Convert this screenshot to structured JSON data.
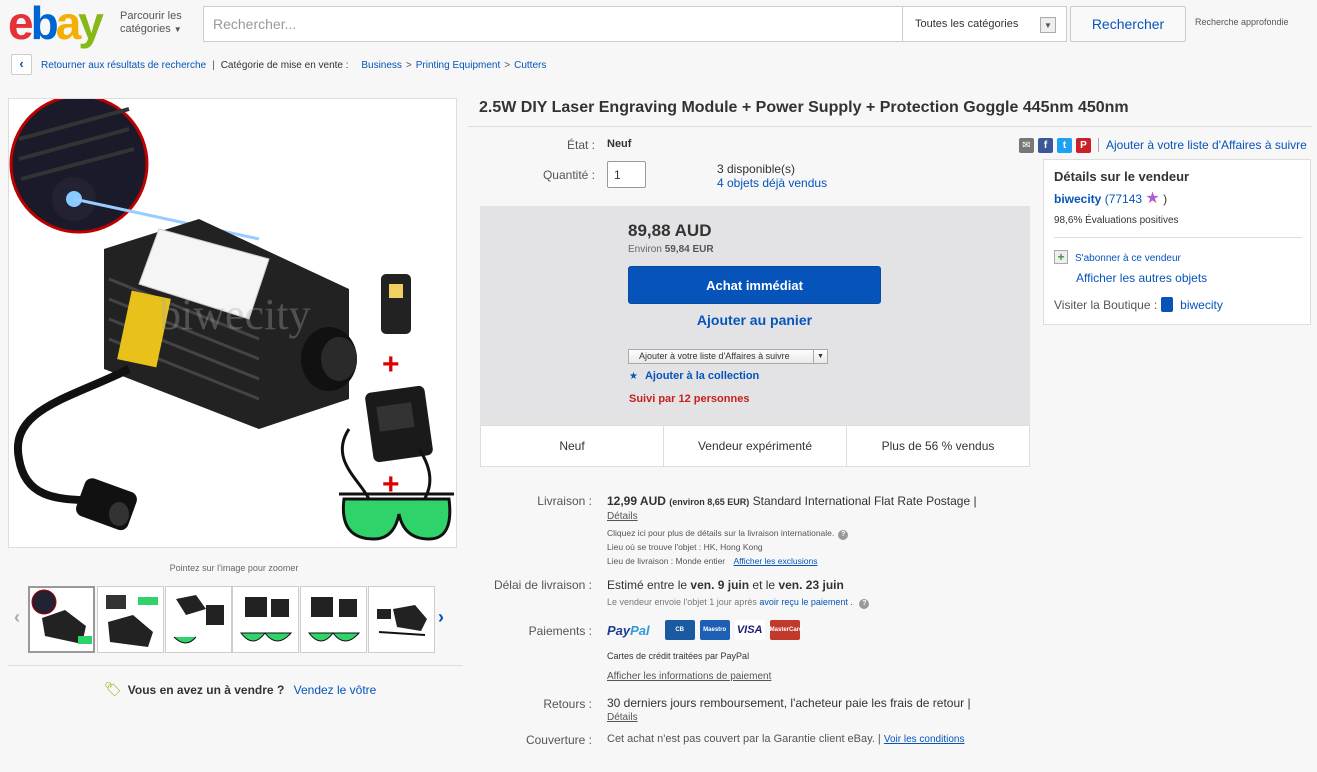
{
  "header": {
    "logo_letters": [
      "e",
      "b",
      "a",
      "y"
    ],
    "logo_colors": [
      "#e53238",
      "#0064d2",
      "#f5af02",
      "#86b817"
    ],
    "browse_line1": "Parcourir les",
    "browse_line2": "catégories",
    "search_placeholder": "Rechercher...",
    "category_select": "Toutes les catégories",
    "search_button": "Rechercher",
    "advanced_search": "Recherche approfondie"
  },
  "breadcrumb": {
    "back_label": "Retourner aux résultats de recherche",
    "category_label": "Catégorie de mise en vente :",
    "items": [
      "Business",
      "Printing Equipment",
      "Cutters"
    ]
  },
  "gallery": {
    "zoom_hint": "Pointez sur l'image pour zoomer",
    "watermark": "biwecity",
    "thumb_count": 6
  },
  "sell_question": {
    "question": "Vous en avez un à vendre ?",
    "link": "Vendez le vôtre"
  },
  "item": {
    "title": "2.5W DIY Laser Engraving Module + Power Supply + Protection Goggle 445nm 450nm",
    "condition_label": "État :",
    "condition_value": "Neuf",
    "quantity_label": "Quantité :",
    "quantity_value": "1",
    "available": "3 disponible(s)",
    "sold": "4 objets déjà vendus"
  },
  "share": {
    "watch_link": "Ajouter à votre liste d'Affaires à suivre"
  },
  "buybox": {
    "price": "89,88 AUD",
    "approx_prefix": "Environ",
    "approx_value": "59,84 EUR",
    "buy_now": "Achat immédiat",
    "add_to_cart": "Ajouter au panier",
    "watch_dropdown": "Ajouter à votre liste d'Affaires à suivre",
    "add_collection": "Ajouter à la collection",
    "followers": "Suivi par 12 personnes"
  },
  "badges": [
    "Neuf",
    "Vendeur expérimenté",
    "Plus de 56 % vendus"
  ],
  "seller": {
    "title": "Détails sur le vendeur",
    "name": "biwecity",
    "score": "(77143",
    "score_close": ")",
    "positive": "98,6% Évaluations positives",
    "subscribe": "S'abonner à ce vendeur",
    "other_items": "Afficher les autres objets",
    "visit_shop": "Visiter la Boutique :",
    "shop_name": "biwecity"
  },
  "shipping": {
    "label": "Livraison :",
    "price": "12,99 AUD",
    "approx": "(environ 8,65 EUR)",
    "service": "Standard International Flat Rate Postage |",
    "details": "Détails",
    "info1": "Cliquez ici pour plus de détails sur la livraison internationale.",
    "info2": "Lieu où se trouve l'objet :  HK, Hong Kong",
    "info3_prefix": "Lieu de livraison :  Monde entier",
    "info3_link": "Afficher les exclusions"
  },
  "delivery": {
    "label": "Délai de livraison :",
    "prefix": "Estimé entre le",
    "date1": "ven. 9 juin",
    "middle": "et le",
    "date2": "ven. 23 juin",
    "note": "Le vendeur envoie l'objet 1 jour après",
    "note_link": "avoir reçu le paiement ."
  },
  "payment": {
    "label": "Paiements :",
    "paypal_a": "Pay",
    "paypal_b": "Pal",
    "cards": [
      "CB",
      "Maestro",
      "VISA",
      "MasterCard"
    ],
    "card_colors": [
      "#1b5aa0",
      "#1c5fb5",
      "#1a1f71",
      "#c0392b"
    ],
    "processed": "Cartes de crédit traitées par PayPal",
    "info_link": "Afficher les informations de paiement"
  },
  "returns": {
    "label": "Retours :",
    "value": "30 derniers jours remboursement, l'acheteur paie les frais de retour |",
    "details": "Détails"
  },
  "coverage": {
    "label": "Couverture :",
    "value": "Cet achat n'est pas couvert par la Garantie client eBay. |",
    "link": "Voir les conditions"
  }
}
